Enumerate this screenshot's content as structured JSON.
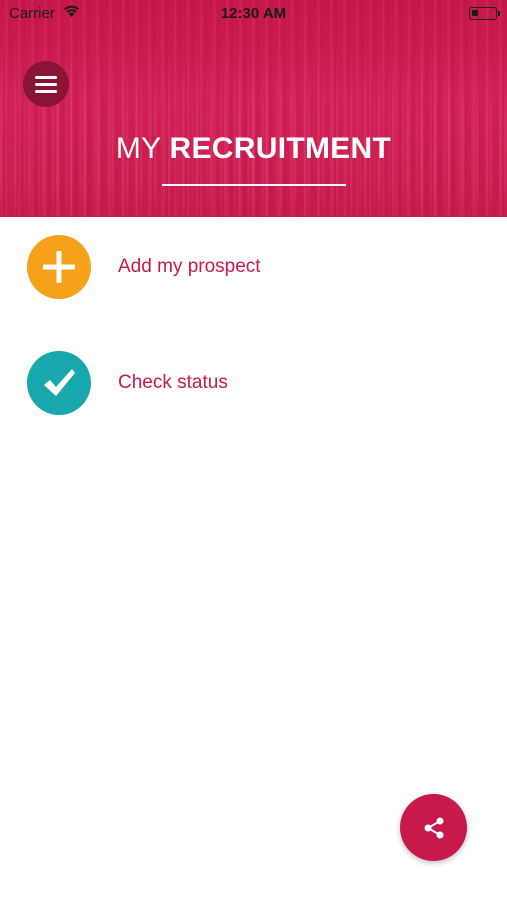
{
  "status_bar": {
    "carrier": "Carrier",
    "time": "12:30 AM",
    "battery_level": 0.25
  },
  "header": {
    "title_regular": "MY",
    "title_bold": "RECRUITMENT",
    "menu_icon": "hamburger-icon"
  },
  "list": [
    {
      "label": "Add my prospect",
      "icon": "plus-icon",
      "icon_color": "#f7a01a"
    },
    {
      "label": "Check status",
      "icon": "checkmark-icon",
      "icon_color": "#17a8ad"
    }
  ],
  "share": {
    "icon": "share-icon"
  },
  "colors": {
    "brand": "#c8194b",
    "menu_button": "#8a1436",
    "add_icon": "#f7a01a",
    "check_icon": "#17a8ad"
  }
}
